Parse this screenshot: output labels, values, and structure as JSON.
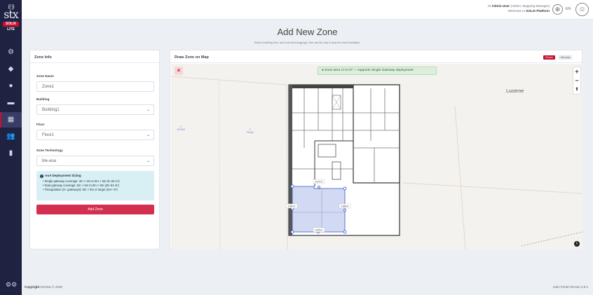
{
  "sidebar": {
    "logo": {
      "waves": "((·))",
      "wordmark": "stx",
      "brand": "SOLIX",
      "edition": "LITE"
    },
    "items": [
      {
        "icon": "dashboard-icon",
        "glyph": "⚙",
        "active": false
      },
      {
        "icon": "tag-icon",
        "glyph": "◆",
        "active": false
      },
      {
        "icon": "circle-icon",
        "glyph": "●",
        "active": false
      },
      {
        "icon": "tablet-icon",
        "glyph": "▬",
        "active": false
      },
      {
        "icon": "building-icon",
        "glyph": "▦",
        "active": true
      },
      {
        "icon": "users-icon",
        "glyph": "👥",
        "active": false
      },
      {
        "icon": "document-icon",
        "glyph": "▮",
        "active": false
      }
    ],
    "settings_glyph": "⚙⚙"
  },
  "header": {
    "greeting_prefix": "Hi",
    "user_name": "Admin User",
    "roles": "(Admin, Mapping Manager)",
    "welcome_prefix": "Welcome to",
    "platform": "SOLIX Platform",
    "language": "EN"
  },
  "page": {
    "title": "Add New Zone",
    "subtitle": "Select a building, floor, and zone technology type, then use the map to draw the zone boundaries."
  },
  "zone_info": {
    "title": "Zone Info",
    "zone_name_label": "Zone Name",
    "zone_name_value": "Zone1",
    "building_label": "Building",
    "building_value": "Building1",
    "floor_label": "Floor",
    "floor_value": "Floor1",
    "tech_label": "Zone Technology",
    "tech_value": "ble-aoa",
    "sizing": {
      "title": "AoA Deployment Sizing",
      "lines": [
        "Single gateway coverage: 3m × 3m to 5m × 5m (9–25 m²)",
        "Dual gateway coverage: 5m × 5m to 8m × 8m (25–64 m²)",
        "Triangulation (3+ gateways): 8m × 8m or larger (64+ m²)"
      ]
    },
    "add_button": "Add Zone"
  },
  "map_panel": {
    "title": "Draw Zone on Map",
    "floor_badge": "Floor1",
    "tech_badge": "ble-aoa",
    "close_glyph": "×",
    "toast": "Zone area 17.6 m² — supports Single Gateway deployment.",
    "zoom_in": "+",
    "zoom_out": "−",
    "compass": "⬆",
    "city": "Lucerne",
    "poi_1": "JADAM",
    "poi_2": "Ethige",
    "measure_top": "4.97 m",
    "measure_left": "2.84 m",
    "measure_right": "2.88 m",
    "measure_bottom": "4.95 m",
    "attribution": "i"
  },
  "footer": {
    "copyright_label": "Copyright",
    "copyright_text": "Sentrax © 2026",
    "version": "Solix Portal Version 2.9.2"
  },
  "colors": {
    "sidebar": "#1f2240",
    "accent": "#c8102e",
    "button": "#d32f4e",
    "zone_fill": "#c9d3f0",
    "zone_stroke": "#3a57c4"
  }
}
